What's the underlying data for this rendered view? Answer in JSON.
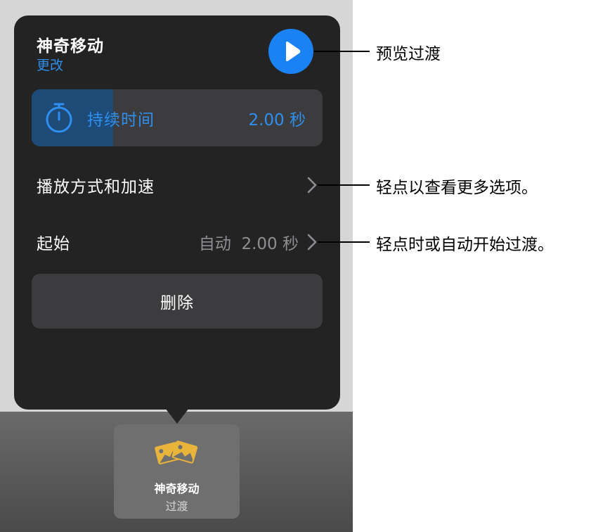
{
  "popover": {
    "title": "神奇移动",
    "change_link": "更改",
    "play_button_icon": "play-icon",
    "duration": {
      "icon": "stopwatch-icon",
      "label": "持续时间",
      "value": "2.00 秒",
      "slider_fraction": 0.28
    },
    "playback_row": {
      "label": "播放方式和加速",
      "icon": "chevron-right-icon"
    },
    "start_row": {
      "label": "起始",
      "value": "自动  2.00 秒",
      "icon": "chevron-right-icon"
    },
    "delete_button": "删除"
  },
  "toolbar": {
    "transition_tile": {
      "icon": "photos-transition-icon",
      "title": "神奇移动",
      "subtitle": "过渡"
    }
  },
  "callouts": {
    "preview": "预览过渡",
    "more_options": "轻点以查看更多选项。",
    "start": "轻点时或自动开始过渡。"
  },
  "colors": {
    "accent_blue": "#1a82f2",
    "popover_bg": "#232323",
    "row_bg": "#3c3c3e",
    "tile_icon_gold": "#e9b43a"
  }
}
